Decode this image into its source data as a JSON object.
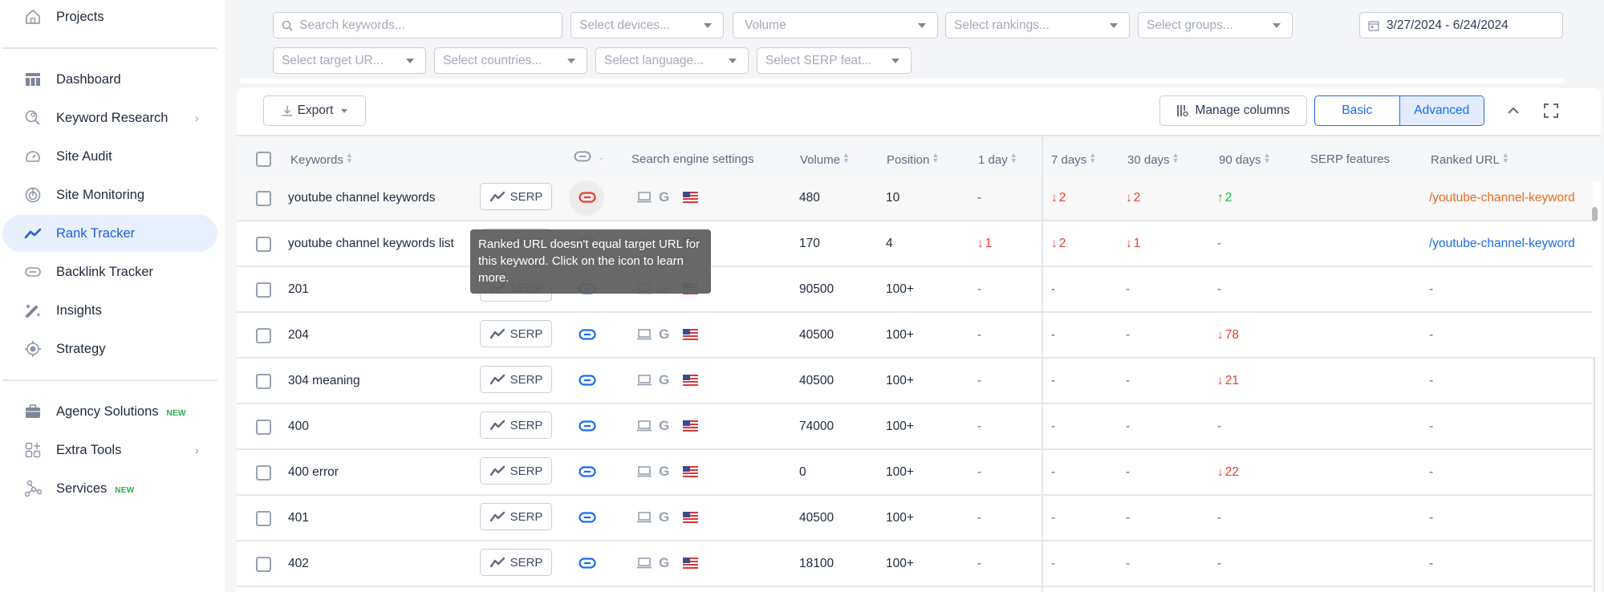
{
  "sidebar": {
    "items": [
      {
        "label": "Projects",
        "icon": "home-icon"
      },
      {
        "label": "Dashboard",
        "icon": "dashboard-icon"
      },
      {
        "label": "Keyword Research",
        "icon": "keyword-research-icon",
        "has_submenu": true
      },
      {
        "label": "Site Audit",
        "icon": "gauge-icon"
      },
      {
        "label": "Site Monitoring",
        "icon": "monitoring-icon"
      },
      {
        "label": "Rank Tracker",
        "icon": "trend-icon",
        "active": true
      },
      {
        "label": "Backlink Tracker",
        "icon": "link-icon"
      },
      {
        "label": "Insights",
        "icon": "magic-wand-icon"
      },
      {
        "label": "Strategy",
        "icon": "target-icon"
      },
      {
        "label": "Agency Solutions",
        "icon": "briefcase-icon",
        "badge": "NEW"
      },
      {
        "label": "Extra Tools",
        "icon": "extra-tools-icon",
        "has_submenu": true
      },
      {
        "label": "Services",
        "icon": "services-icon",
        "badge": "NEW"
      }
    ],
    "chevron": "›"
  },
  "filters": {
    "search_placeholder": "Search keywords...",
    "devices": "Select devices...",
    "volume": "Volume",
    "rankings": "Select rankings...",
    "groups": "Select groups...",
    "date_range": "3/27/2024 - 6/24/2024",
    "target_url": "Select target UR...",
    "countries": "Select countries...",
    "language": "Select language...",
    "serp_features": "Select SERP feat..."
  },
  "toolbar": {
    "export_label": "Export",
    "manage_columns_label": "Manage columns",
    "view_modes": [
      "Basic",
      "Advanced"
    ],
    "active_view": "Advanced"
  },
  "table": {
    "columns": {
      "keywords": "Keywords",
      "search_engine": "Search engine settings",
      "volume": "Volume",
      "position": "Position",
      "d1": "1 day",
      "d7": "7 days",
      "d30": "30 days",
      "d90": "90 days",
      "serp_features": "SERP features",
      "ranked_url": "Ranked URL"
    },
    "serp_label": "SERP",
    "sort_glyph": "⇕",
    "rows": [
      {
        "keyword": "youtube channel keywords",
        "volume": "480",
        "position": "10",
        "d1": "-",
        "d7": "2",
        "d7_dir": "down",
        "d30": "2",
        "d30_dir": "down",
        "d90": "2",
        "d90_dir": "up",
        "serp": "",
        "ranked_url": "/youtube-channel-keyword",
        "url_status": "mismatch",
        "link_status": "mismatch"
      },
      {
        "keyword": "youtube channel keywords list",
        "volume": "170",
        "position": "4",
        "d1": "1",
        "d1_dir": "down",
        "d7": "2",
        "d7_dir": "down",
        "d30": "1",
        "d30_dir": "down",
        "d90": "-",
        "serp": "",
        "ranked_url": "/youtube-channel-keyword",
        "url_status": "ok"
      },
      {
        "keyword": "201",
        "volume": "90500",
        "position": "100+",
        "d1": "-",
        "d7": "-",
        "d30": "-",
        "d90": "-",
        "serp": "",
        "ranked_url": "-"
      },
      {
        "keyword": "204",
        "volume": "40500",
        "position": "100+",
        "d1": "-",
        "d7": "-",
        "d30": "-",
        "d90": "78",
        "d90_dir": "down",
        "serp": "",
        "ranked_url": "-"
      },
      {
        "keyword": "304 meaning",
        "volume": "40500",
        "position": "100+",
        "d1": "-",
        "d7": "-",
        "d30": "-",
        "d90": "21",
        "d90_dir": "down",
        "serp": "",
        "ranked_url": "-"
      },
      {
        "keyword": "400",
        "volume": "74000",
        "position": "100+",
        "d1": "-",
        "d7": "-",
        "d30": "-",
        "d90": "-",
        "serp": "",
        "ranked_url": "-"
      },
      {
        "keyword": "400 error",
        "volume": "0",
        "position": "100+",
        "d1": "-",
        "d7": "-",
        "d30": "-",
        "d90": "22",
        "d90_dir": "down",
        "serp": "",
        "ranked_url": "-"
      },
      {
        "keyword": "401",
        "volume": "40500",
        "position": "100+",
        "d1": "-",
        "d7": "-",
        "d30": "-",
        "d90": "-",
        "serp": "",
        "ranked_url": "-"
      },
      {
        "keyword": "402",
        "volume": "18100",
        "position": "100+",
        "d1": "-",
        "d7": "-",
        "d30": "-",
        "d90": "-",
        "serp": "",
        "ranked_url": "-"
      }
    ]
  },
  "tooltip": {
    "text": "Ranked URL doesn't equal target URL for this keyword. Click on the icon to learn more."
  },
  "arrows": {
    "down": "↓",
    "up": "↑"
  },
  "colors": {
    "accent": "#1a6cf0",
    "down": "#ea3d2f",
    "up": "#1fb84a",
    "mismatch_url": "#f06a1e",
    "new_badge": "#22b14c"
  }
}
